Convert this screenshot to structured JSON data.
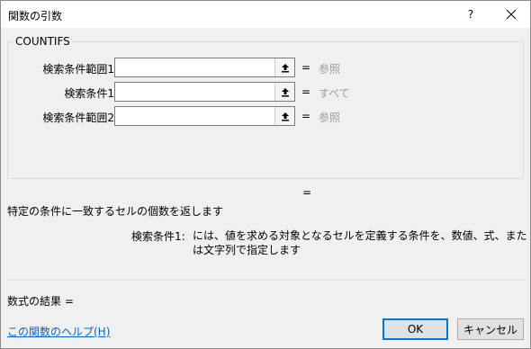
{
  "window": {
    "title": "関数の引数",
    "help_label": "?"
  },
  "function": {
    "name": "COUNTIFS",
    "arguments": [
      {
        "label": "検索条件範囲1",
        "value": "",
        "result": "参照"
      },
      {
        "label": "検索条件1",
        "value": "",
        "result": "すべて"
      },
      {
        "label": "検索条件範囲2",
        "value": "",
        "result": "参照"
      }
    ],
    "equals_sign": "=",
    "result_equals": "=",
    "description": "特定の条件に一致するセルの個数を返します",
    "argument_help_name": "検索条件1:",
    "argument_help_text": "には、値を求める対象となるセルを定義する条件を、数値、式、または文字列で指定します"
  },
  "footer": {
    "formula_result_label": "数式の結果",
    "formula_result_equals": "=",
    "help_link": "この関数のヘルプ(H)",
    "ok_label": "OK",
    "cancel_label": "キャンセル"
  },
  "icons": {
    "collapse": "collapse-dialog-icon",
    "close": "close-icon"
  },
  "colors": {
    "accent": "#0078d7",
    "link": "#0066cc",
    "muted_value": "#9d9d9d"
  }
}
